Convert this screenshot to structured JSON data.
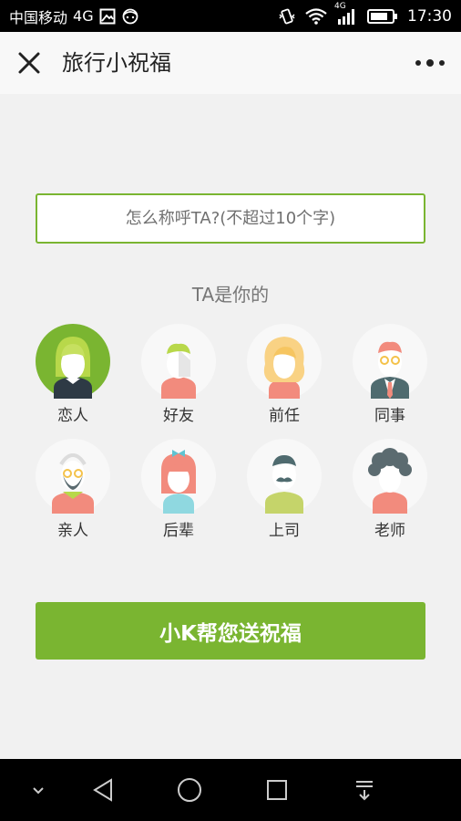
{
  "status_bar": {
    "carrier": "中国移动",
    "network": "4G",
    "signal_label": "4G",
    "time": "17:30",
    "icons": [
      "gallery-icon",
      "face-icon",
      "vibrate-icon",
      "wifi-icon",
      "signal-icon",
      "battery-icon"
    ]
  },
  "nav": {
    "title": "旅行小祝福",
    "close_icon": "close-icon",
    "more_icon": "more-icon"
  },
  "form": {
    "name_placeholder": "怎么称呼TA?(不超过10个字)",
    "name_value": ""
  },
  "relation": {
    "label": "TA是你的",
    "options": [
      {
        "label": "恋人",
        "selected": true
      },
      {
        "label": "好友",
        "selected": false
      },
      {
        "label": "前任",
        "selected": false
      },
      {
        "label": "同事",
        "selected": false
      },
      {
        "label": "亲人",
        "selected": false
      },
      {
        "label": "后辈",
        "selected": false
      },
      {
        "label": "上司",
        "selected": false
      },
      {
        "label": "老师",
        "selected": false
      }
    ]
  },
  "submit_label": "小K帮您送祝福",
  "colors": {
    "accent": "#7ab531",
    "background": "#f1f1f1"
  }
}
